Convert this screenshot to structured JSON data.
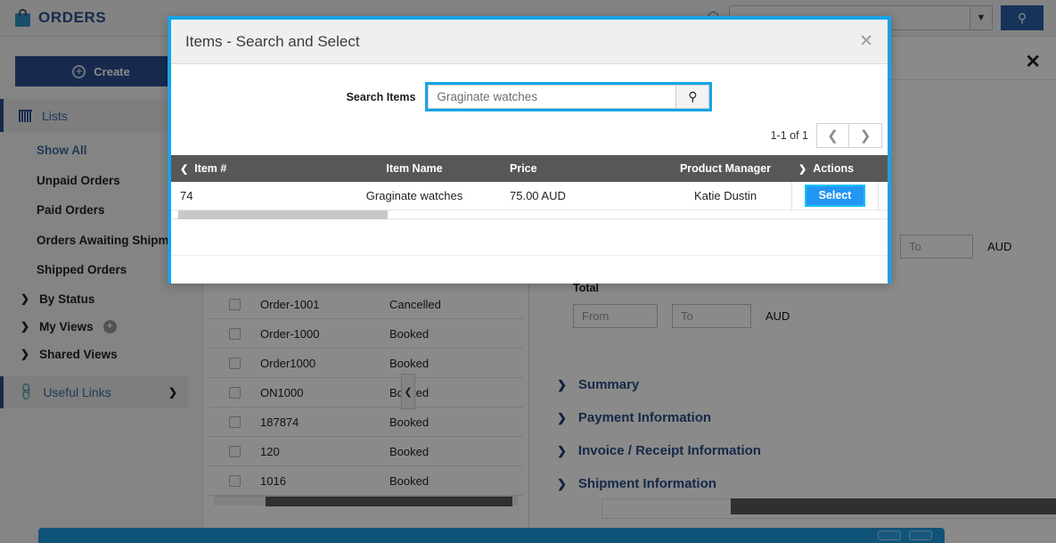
{
  "app": {
    "brand": "ORDERS",
    "brand_icon": "shopping-bag-icon",
    "accent_blue": "#2c4f8e",
    "highlight_cyan": "#17a3e8"
  },
  "topbar": {
    "search_value": "",
    "search_placeholder": "",
    "caret_icon": "chevron-down-icon",
    "search_button_icon": "search-icon",
    "home_icon": "home-icon"
  },
  "sidebar": {
    "create_label": "Create",
    "create_icon": "plus-circle-icon",
    "section_label": "Lists",
    "section_icon": "grid-icon",
    "items": [
      {
        "label": "Show All",
        "active": true
      },
      {
        "label": "Unpaid Orders",
        "active": false
      },
      {
        "label": "Paid Orders",
        "active": false
      },
      {
        "label": "Orders Awaiting Shipment",
        "active": false
      },
      {
        "label": "Shipped Orders",
        "active": false
      }
    ],
    "groups": [
      {
        "label": "By Status",
        "has_add": false
      },
      {
        "label": "My Views",
        "has_add": true
      },
      {
        "label": "Shared Views",
        "has_add": false
      }
    ],
    "useful_links_label": "Useful Links",
    "useful_links_icon": "link-icon",
    "useful_links_chevron": "chevron-right-icon"
  },
  "orders_list": {
    "rows": [
      {
        "id": "Order-1001",
        "status": "Cancelled"
      },
      {
        "id": "Order-1000",
        "status": "Booked"
      },
      {
        "id": "Order1000",
        "status": "Booked"
      },
      {
        "id": "ON1000",
        "status": "Booked"
      },
      {
        "id": "187874",
        "status": "Booked"
      },
      {
        "id": "120",
        "status": "Booked"
      },
      {
        "id": "1016",
        "status": "Booked"
      }
    ]
  },
  "detail_panel": {
    "close_icon": "close-icon",
    "total_label": "Total",
    "from_placeholder": "From",
    "to_placeholder": "To",
    "currency": "AUD",
    "upper_to_placeholder": "To",
    "upper_currency": "AUD",
    "accordions": [
      {
        "label": "Summary",
        "icon": "chevron-right-icon"
      },
      {
        "label": "Payment Information",
        "icon": "chevron-right-icon"
      },
      {
        "label": "Invoice / Receipt Information",
        "icon": "chevron-right-icon"
      },
      {
        "label": "Shipment Information",
        "icon": "chevron-right-icon"
      }
    ]
  },
  "modal": {
    "title": "Items - Search and Select",
    "close_icon": "close-icon",
    "search_label": "Search Items",
    "search_value": "Graginate watches",
    "search_button_icon": "search-icon",
    "pagination": {
      "count_text": "1-1 of 1",
      "prev_icon": "chevron-left-icon",
      "next_icon": "chevron-right-icon"
    },
    "table": {
      "columns": [
        {
          "label": "Item #",
          "icon": "chevron-left-icon"
        },
        {
          "label": "Item Name",
          "icon": ""
        },
        {
          "label": "Price",
          "icon": ""
        },
        {
          "label": "Product Manager",
          "icon": ""
        },
        {
          "label": "Actions",
          "icon": "chevron-right-icon"
        }
      ],
      "rows": [
        {
          "item_no": "74",
          "item_name": "Graginate watches",
          "price": "75.00 AUD",
          "product_manager": "Katie Dustin",
          "action_label": "Select"
        }
      ]
    }
  }
}
